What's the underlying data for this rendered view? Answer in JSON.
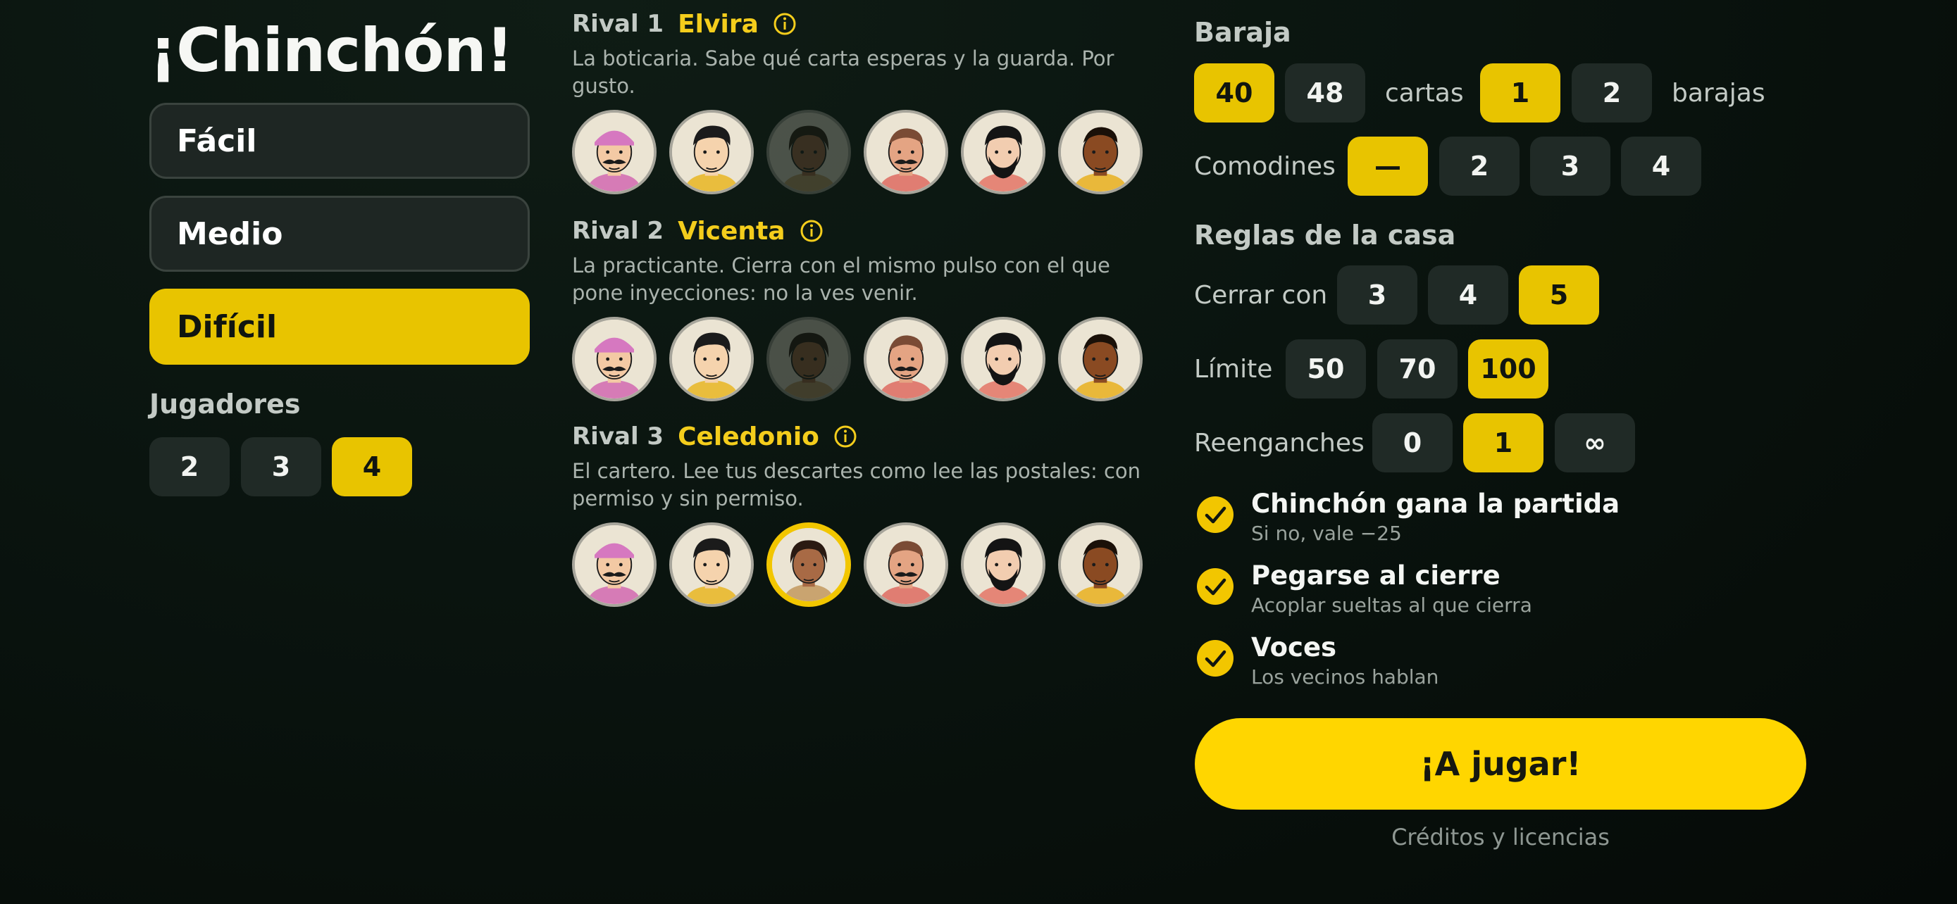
{
  "app": {
    "title": "¡Chinchón!"
  },
  "difficulty": {
    "options": [
      {
        "label": "Fácil",
        "selected": false
      },
      {
        "label": "Medio",
        "selected": false
      },
      {
        "label": "Difícil",
        "selected": true
      }
    ]
  },
  "players": {
    "label": "Jugadores",
    "options": [
      "2",
      "3",
      "4"
    ],
    "selected": "4"
  },
  "rivals": [
    {
      "label": "Rival 1",
      "name": "Elvira",
      "description": "La boticaria. Sabe qué carta esperas y la guarda. Por gusto.",
      "selected_avatar": 3,
      "dimmed_avatar": 3
    },
    {
      "label": "Rival 2",
      "name": "Vicenta",
      "description": "La practicante. Cierra con el mismo pulso con el que pone inyecciones: no la ves venir.",
      "selected_avatar": 3,
      "dimmed_avatar": 3
    },
    {
      "label": "Rival 3",
      "name": "Celedonio",
      "description": "El cartero. Lee tus descartes como lee las postales: con permiso y sin permiso.",
      "selected_avatar": 3,
      "dimmed_avatar": 0
    }
  ],
  "avatars": [
    {
      "name": "pink-beanie-mustache-avatar",
      "skin": "#f3c9a4",
      "shirt": "#d67bb6",
      "hair": "#d678c0"
    },
    {
      "name": "black-hair-young-avatar",
      "skin": "#f5d3ad",
      "shirt": "#e9bd3d",
      "hair": "#1b1b1b"
    },
    {
      "name": "curly-hair-woman-avatar",
      "skin": "#a86a45",
      "shirt": "#c9a470",
      "hair": "#2a1a12"
    },
    {
      "name": "handlebar-mustache-avatar",
      "skin": "#e4a483",
      "shirt": "#e07d72",
      "hair": "#7a4b35"
    },
    {
      "name": "bearded-man-avatar",
      "skin": "#f2cdb0",
      "shirt": "#e58677",
      "hair": "#141414"
    },
    {
      "name": "dark-skin-man-avatar",
      "skin": "#8a4a22",
      "shirt": "#e9b83a",
      "hair": "#1a1008"
    }
  ],
  "settings": {
    "deck": {
      "label": "Baraja",
      "cards_options": [
        "40",
        "48"
      ],
      "cards_selected": "40",
      "cards_label": "cartas",
      "decks_options": [
        "1",
        "2"
      ],
      "decks_selected": "1",
      "decks_label": "barajas"
    },
    "jokers": {
      "label": "Comodines",
      "options": [
        "—",
        "2",
        "3",
        "4"
      ],
      "selected": "—"
    },
    "house_rules": {
      "label": "Reglas de la casa",
      "close_with": {
        "label": "Cerrar con",
        "options": [
          "3",
          "4",
          "5"
        ],
        "selected": "5"
      },
      "limit": {
        "label": "Límite",
        "options": [
          "50",
          "70",
          "100"
        ],
        "selected": "100"
      },
      "rejoins": {
        "label": "Reenganches",
        "options": [
          "0",
          "1",
          "∞"
        ],
        "selected": "1"
      }
    },
    "toggles": [
      {
        "title": "Chinchón gana la partida",
        "subtitle": "Si no, vale −25",
        "checked": true
      },
      {
        "title": "Pegarse al cierre",
        "subtitle": "Acoplar sueltas al que cierra",
        "checked": true
      },
      {
        "title": "Voces",
        "subtitle": "Los vecinos hablan",
        "checked": true
      }
    ]
  },
  "play_button": {
    "label": "¡A jugar!"
  },
  "credits_link": {
    "label": "Créditos y licencias"
  },
  "colors": {
    "accent": "#e8c400",
    "play": "#ffd600",
    "chip": "#202a26",
    "background": "#0a140f"
  }
}
